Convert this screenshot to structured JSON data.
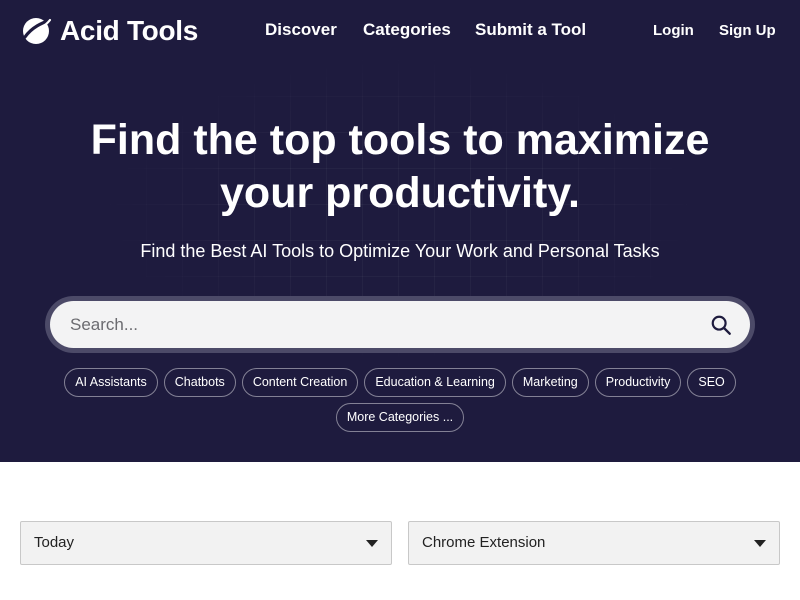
{
  "brand": {
    "name": "Acid Tools",
    "logo_icon": "planet-logo-icon"
  },
  "nav": {
    "items": [
      {
        "label": "Discover"
      },
      {
        "label": "Categories"
      },
      {
        "label": "Submit a Tool"
      }
    ],
    "login_label": "Login",
    "signup_label": "Sign Up"
  },
  "hero": {
    "headline_line1": "Find the top tools to maximize",
    "headline_line2": "your productivity.",
    "subheadline": "Find the Best AI Tools to Optimize Your Work and Personal Tasks"
  },
  "search": {
    "placeholder": "Search...",
    "value": "",
    "icon": "search-icon"
  },
  "categories": [
    {
      "label": "AI Assistants"
    },
    {
      "label": "Chatbots"
    },
    {
      "label": "Content Creation"
    },
    {
      "label": "Education & Learning"
    },
    {
      "label": "Marketing"
    },
    {
      "label": "Productivity"
    },
    {
      "label": "SEO"
    },
    {
      "label": "More Categories ..."
    }
  ],
  "filters": {
    "time": {
      "selected": "Today"
    },
    "platform": {
      "selected": "Chrome Extension"
    }
  },
  "colors": {
    "hero_bg": "#1e1b3e",
    "search_ring": "#4c4a68",
    "search_bg": "#f3f3f4",
    "select_bg": "#f2f2f2"
  }
}
